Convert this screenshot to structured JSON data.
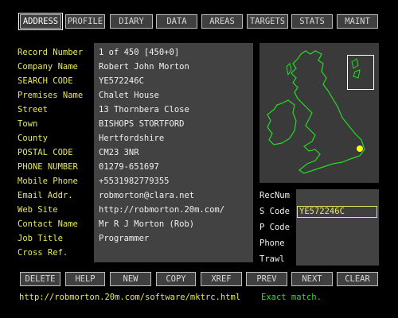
{
  "tabs": [
    {
      "label": "ADDRESS",
      "active": true
    },
    {
      "label": "PROFILE"
    },
    {
      "label": "DIARY"
    },
    {
      "label": "DATA"
    },
    {
      "label": "AREAS"
    },
    {
      "label": "TARGETS"
    },
    {
      "label": "STATS"
    },
    {
      "label": "MAINT"
    }
  ],
  "record": {
    "labels": [
      "Record Number",
      "Company Name",
      "SEARCH CODE",
      "Premises Name",
      "Street",
      "Town",
      "County",
      "POSTAL CODE",
      "PHONE NUMBER",
      "Mobile Phone",
      "Email Addr.",
      "Web Site",
      "Contact Name",
      "Job Title",
      "Cross Ref."
    ],
    "values": [
      "1 of 450 [450+0]",
      "Robert John Morton",
      "YE572246C",
      "Chalet House",
      "13 Thornbera Close",
      "BISHOPS STORTFORD",
      "Hertfordshire",
      "CM23 3NR",
      "01279-651697",
      "+5531982779355",
      "robmorton@clara.net",
      "http://robmorton.20m.com/",
      "Mr R J Morton (Rob)",
      "Programmer",
      ""
    ]
  },
  "search": {
    "labels": [
      "RecNum",
      "S Code",
      "P Code",
      "Phone",
      "Trawl"
    ],
    "scode_value": "YE572246C"
  },
  "buttons": [
    "DELETE",
    "HELP",
    "NEW",
    "COPY",
    "XREF",
    "PREV",
    "NEXT",
    "CLEAR"
  ],
  "status": {
    "url": "http://robmorton.20m.com/software/mktrc.html",
    "message": "Exact match."
  },
  "colors": {
    "label_yellow": "#e8e85a",
    "status_green": "#33dd33",
    "map_green": "#22dd22",
    "marker_yellow": "#ffff00"
  }
}
